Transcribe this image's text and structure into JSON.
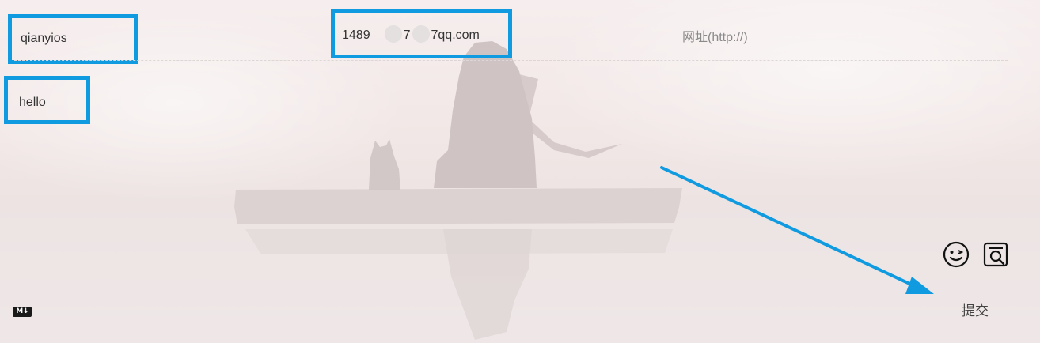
{
  "form": {
    "nick": {
      "value": "qianyios"
    },
    "mail": {
      "prefix": "1489",
      "middle": "7",
      "suffix": "7qq.com"
    },
    "link": {
      "placeholder": "网址(http://)"
    },
    "comment": {
      "value": "hello"
    }
  },
  "toolbar": {
    "markdown_label": "M↓",
    "emoji_icon": "emoji-icon",
    "preview_icon": "preview-icon"
  },
  "actions": {
    "submit_label": "提交"
  },
  "colors": {
    "highlight": "#109be0",
    "arrow": "#109be0"
  }
}
